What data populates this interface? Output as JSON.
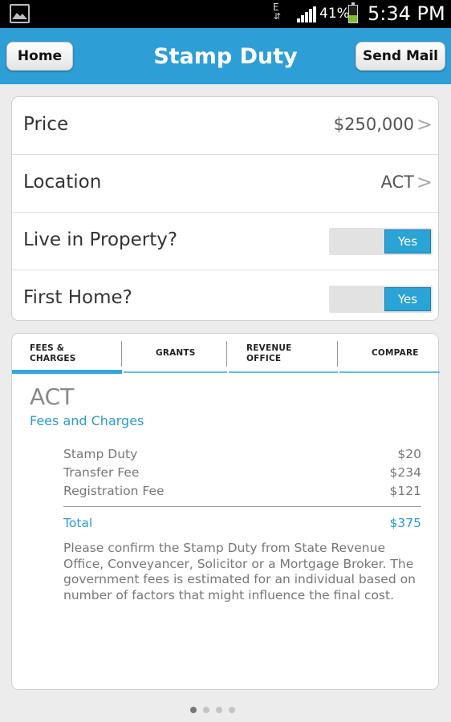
{
  "status_bar": {
    "network": "E",
    "battery_percent": "41%",
    "battery_level": 0.41,
    "time": "5:34 PM"
  },
  "header": {
    "title": "Stamp Duty",
    "home_label": "Home",
    "send_mail_label": "Send Mail",
    "accent_color": "#2e9ed6"
  },
  "settings": [
    {
      "label": "Price",
      "value": "$250,000",
      "type": "disclosure"
    },
    {
      "label": "Location",
      "value": "ACT",
      "type": "disclosure"
    },
    {
      "label": "Live in Property?",
      "value": "Yes",
      "type": "toggle"
    },
    {
      "label": "First Home?",
      "value": "Yes",
      "type": "toggle"
    }
  ],
  "tabs": [
    {
      "line1": "FEES &",
      "line2": "CHARGES",
      "active": true
    },
    {
      "line1": "GRANTS",
      "line2": "",
      "active": false
    },
    {
      "line1": "REVENUE",
      "line2": "OFFICE",
      "active": false
    },
    {
      "line1": "COMPARE",
      "line2": "",
      "active": false
    }
  ],
  "panel": {
    "region": "ACT",
    "subtitle": "Fees and Charges",
    "fees": [
      {
        "name": "Stamp Duty",
        "amount": "$20"
      },
      {
        "name": "Transfer Fee",
        "amount": "$234"
      },
      {
        "name": "Registration Fee",
        "amount": "$121"
      }
    ],
    "total_label": "Total",
    "total_amount": "$375",
    "note": "Please confirm the Stamp Duty from State Revenue Office, Conveyancer, Solicitor or a Mortgage Broker. The government fees is estimated for an individual based on number of factors that might influence the final cost."
  },
  "pager": {
    "pages": 4,
    "current": 1
  }
}
